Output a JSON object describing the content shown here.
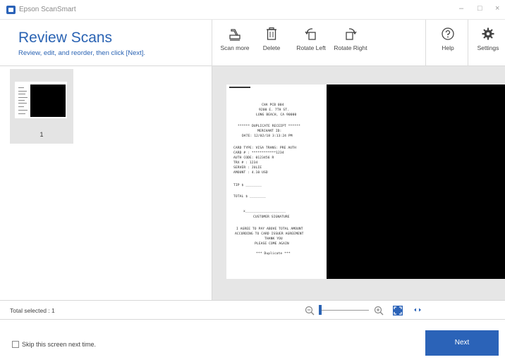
{
  "window": {
    "title": "Epson ScanSmart",
    "minimize_glyph": "–",
    "maximize_glyph": "□",
    "close_glyph": "×"
  },
  "header": {
    "title": "Review Scans",
    "subtitle": "Review, edit, and reorder, then click [Next]."
  },
  "toolbar": {
    "scan_more": {
      "label": "Scan more",
      "icon": "scanner-icon"
    },
    "delete": {
      "label": "Delete",
      "icon": "trash-icon"
    },
    "rotate_left": {
      "label": "Rotate Left",
      "icon": "rotate-left-icon"
    },
    "rotate_right": {
      "label": "Rotate Right",
      "icon": "rotate-right-icon"
    },
    "help": {
      "label": "Help",
      "icon": "help-icon"
    },
    "settings": {
      "label": "Settings",
      "icon": "gear-icon"
    }
  },
  "thumbnails": [
    {
      "page_number": "1",
      "selected": true
    }
  ],
  "receipt_lines": [
    "CHA PCB 004",
    "9200 E. 7TH ST.",
    "LONG BEACH, CA 90000",
    "****** DUPLICATE RECEIPT ******",
    "MERCHANT ID:",
    "DATE: 12/02/18  3:13:24 PM",
    "CARD TYPE: VISA   TRANS: PRE AUTH",
    "CARD # : ************1234",
    "AUTH CODE: 0123456 R",
    "TRX # : 1234",
    "SERVER : JULIE",
    "AMOUNT : 4.10 USD",
    "TIP   $ ________",
    "TOTAL $ ________",
    "x____________________",
    "CUSTOMER SIGNATURE",
    "I AGREE TO PAY ABOVE TOTAL AMOUNT",
    "ACCORDING TO CARD ISSUER AGREEMENT",
    "THANK YOU",
    "PLEASE COME AGAIN",
    "*** Duplicate ***"
  ],
  "status": {
    "total_selected": "Total selected : 1"
  },
  "zoom": {
    "level_fraction": 0.02
  },
  "footer": {
    "skip_label": "Skip this screen next time.",
    "skip_checked": false,
    "next_label": "Next"
  },
  "colors": {
    "accent": "#2b63b8",
    "preview_bg": "#e6e6e6"
  }
}
